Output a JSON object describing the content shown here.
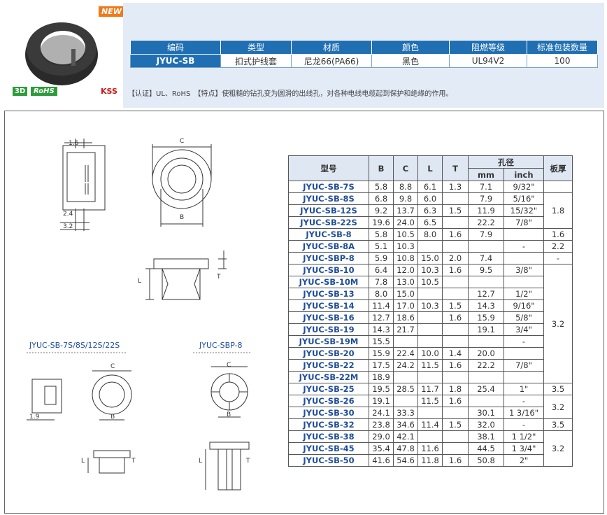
{
  "badges": {
    "new": "NEW",
    "d3": "3D",
    "rohs": "RoHS",
    "kss": "KSS"
  },
  "info_table": {
    "headers": [
      "编码",
      "类型",
      "材质",
      "颜色",
      "阻燃等级",
      "标准包装数量"
    ],
    "row": [
      "JYUC-SB",
      "扣式护线套",
      "尼龙66(PA66)",
      "黑色",
      "UL94V2",
      "100"
    ]
  },
  "cert_line": "【认证】UL、RoHS　【特点】使粗糙的钻孔变为圆滑的出线孔，对各种电线电缆起到保护和绝缘的作用。",
  "drawings": {
    "dim_16": "1.6",
    "dim_24": "2.4",
    "dim_32": "3.2",
    "dim_c": "C",
    "dim_b": "B",
    "dim_l": "L",
    "dim_t": "T",
    "dim_19": "1.9",
    "label_left": "JYUC-SB-7S/8S/12S/22S",
    "label_right": "JYUC-SBP-8"
  },
  "spec_table": {
    "headers": {
      "model": "型号",
      "b": "B",
      "c": "C",
      "l": "L",
      "t": "T",
      "hole": "孔径",
      "mm": "mm",
      "inch": "inch",
      "plate": "板厚"
    },
    "rows": [
      {
        "model": "JYUC-SB-7S",
        "b": "5.8",
        "c": "8.8",
        "l": "6.1",
        "t": "1.3",
        "mm": "7.1",
        "inch": "9/32\""
      },
      {
        "model": "JYUC-SB-8S",
        "b": "6.8",
        "c": "9.8",
        "l": "6.0",
        "t": "",
        "mm": "7.9",
        "inch": "5/16\""
      },
      {
        "model": "JYUC-SB-12S",
        "b": "9.2",
        "c": "13.7",
        "l": "6.3",
        "t": "1.5",
        "mm": "11.9",
        "inch": "15/32\""
      },
      {
        "model": "JYUC-SB-22S",
        "b": "19.6",
        "c": "24.0",
        "l": "6.5",
        "t": "",
        "mm": "22.2",
        "inch": "7/8\""
      },
      {
        "model": "JYUC-SB-8",
        "b": "5.8",
        "c": "10.5",
        "l": "8.0",
        "t": "1.6",
        "mm": "7.9",
        "inch": ""
      },
      {
        "model": "JYUC-SB-8A",
        "b": "5.1",
        "c": "10.3",
        "l": "",
        "t": "",
        "mm": "",
        "inch": "-"
      },
      {
        "model": "JYUC-SBP-8",
        "b": "5.9",
        "c": "10.8",
        "l": "15.0",
        "t": "2.0",
        "mm": "7.4",
        "inch": ""
      },
      {
        "model": "JYUC-SB-10",
        "b": "6.4",
        "c": "12.0",
        "l": "10.3",
        "t": "1.6",
        "mm": "9.5",
        "inch": "3/8\""
      },
      {
        "model": "JYUC-SB-10M",
        "b": "7.8",
        "c": "13.0",
        "l": "10.5",
        "t": "",
        "mm": "",
        "inch": ""
      },
      {
        "model": "JYUC-SB-13",
        "b": "8.0",
        "c": "15.0",
        "l": "",
        "t": "",
        "mm": "12.7",
        "inch": "1/2\""
      },
      {
        "model": "JYUC-SB-14",
        "b": "11.4",
        "c": "17.0",
        "l": "10.3",
        "t": "1.5",
        "mm": "14.3",
        "inch": "9/16\""
      },
      {
        "model": "JYUC-SB-16",
        "b": "12.7",
        "c": "18.6",
        "l": "",
        "t": "1.6",
        "mm": "15.9",
        "inch": "5/8\""
      },
      {
        "model": "JYUC-SB-19",
        "b": "14.3",
        "c": "21.7",
        "l": "",
        "t": "",
        "mm": "19.1",
        "inch": "3/4\""
      },
      {
        "model": "JYUC-SB-19M",
        "b": "15.5",
        "c": "",
        "l": "",
        "t": "",
        "mm": "",
        "inch": "-"
      },
      {
        "model": "JYUC-SB-20",
        "b": "15.9",
        "c": "22.4",
        "l": "10.0",
        "t": "1.4",
        "mm": "20.0",
        "inch": ""
      },
      {
        "model": "JYUC-SB-22",
        "b": "17.5",
        "c": "24.2",
        "l": "11.5",
        "t": "1.6",
        "mm": "22.2",
        "inch": "7/8\""
      },
      {
        "model": "JYUC-SB-22M",
        "b": "18.9",
        "c": "",
        "l": "",
        "t": "",
        "mm": "",
        "inch": ""
      },
      {
        "model": "JYUC-SB-25",
        "b": "19.5",
        "c": "28.5",
        "l": "11.7",
        "t": "1.8",
        "mm": "25.4",
        "inch": "1\""
      },
      {
        "model": "JYUC-SB-26",
        "b": "19.1",
        "c": "",
        "l": "11.5",
        "t": "1.6",
        "mm": "",
        "inch": "-"
      },
      {
        "model": "JYUC-SB-30",
        "b": "24.1",
        "c": "33.3",
        "l": "",
        "t": "",
        "mm": "30.1",
        "inch": "1 3/16\""
      },
      {
        "model": "JYUC-SB-32",
        "b": "23.8",
        "c": "34.6",
        "l": "11.4",
        "t": "1.5",
        "mm": "32.0",
        "inch": "-"
      },
      {
        "model": "JYUC-SB-38",
        "b": "29.0",
        "c": "42.1",
        "l": "",
        "t": "",
        "mm": "38.1",
        "inch": "1 1/2\""
      },
      {
        "model": "JYUC-SB-45",
        "b": "35.4",
        "c": "47.8",
        "l": "11.6",
        "t": "",
        "mm": "44.5",
        "inch": "1 3/4\""
      },
      {
        "model": "JYUC-SB-50",
        "b": "41.6",
        "c": "54.6",
        "l": "11.8",
        "t": "1.6",
        "mm": "50.8",
        "inch": "2\""
      }
    ],
    "plate": [
      "1.8",
      "1.6",
      "2.2",
      "-",
      "3.2",
      "3.5",
      "3.2",
      "3.5",
      "3.2"
    ]
  }
}
